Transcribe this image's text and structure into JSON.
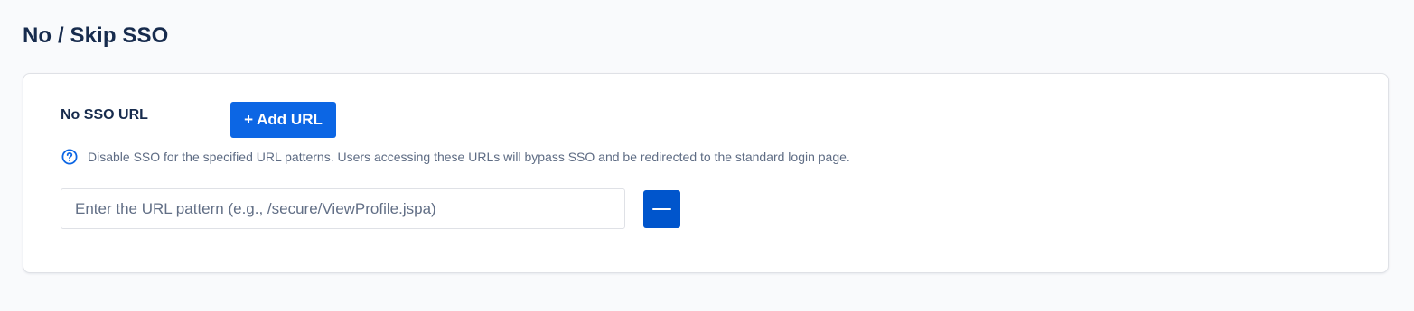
{
  "page": {
    "title": "No / Skip SSO"
  },
  "no_sso": {
    "label": "No SSO URL",
    "add_button_label": "+ Add URL",
    "help_icon": "question-circle-icon",
    "help_text": "Disable SSO for the specified URL patterns. Users accessing these URLs will bypass SSO and be redirected to the standard login page.",
    "url_input": {
      "value": "",
      "placeholder": "Enter the URL pattern (e.g., /secure/ViewProfile.jspa)"
    },
    "remove_icon": "minus-icon"
  },
  "colors": {
    "accent": "#0c66e4",
    "remove_button": "#0055cc",
    "title_text": "#172b4d",
    "help_text": "#5e6c84"
  }
}
